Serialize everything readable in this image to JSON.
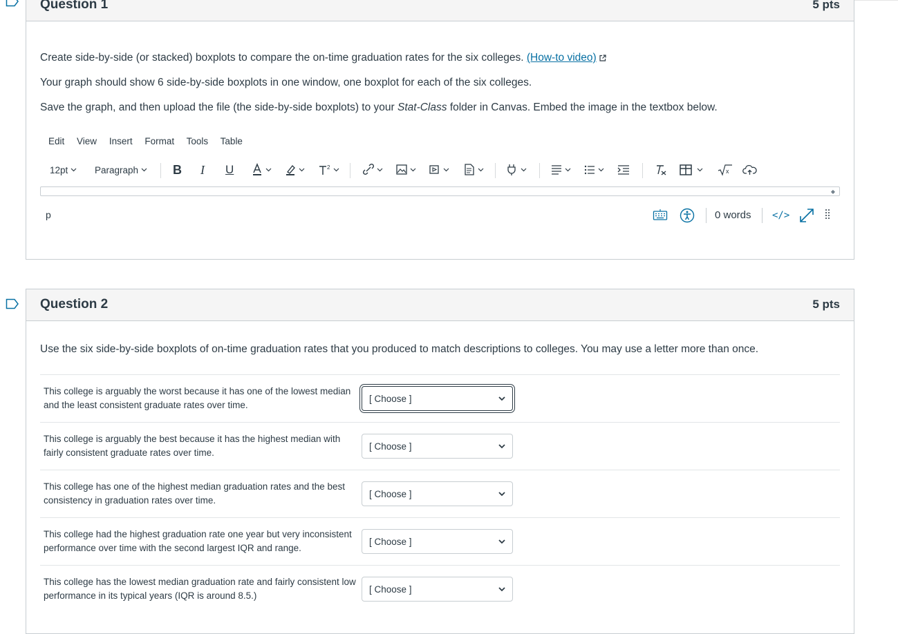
{
  "question1": {
    "title": "Question 1",
    "points": "5 pts",
    "text_1": "Create side-by-side (or stacked) boxplots to compare the on-time graduation rates for the six colleges.",
    "link": "(How-to video)",
    "text_2": "Your graph should show 6 side-by-side boxplots in one window, one boxplot for each of the six colleges.",
    "text_3a": "Save the graph, and then upload the file (the side-by-side boxplots) to your",
    "text_3b": "Stat-Class",
    "text_3c": "folder in Canvas. Embed the image in the textbox below."
  },
  "editor": {
    "menu": [
      "Edit",
      "View",
      "Insert",
      "Format",
      "Tools",
      "Table"
    ],
    "font_size": "12pt",
    "block_format": "Paragraph",
    "path": "p",
    "word_count": "0 words",
    "html_toggle": "</>"
  },
  "question2": {
    "title": "Question 2",
    "points": "5 pts",
    "text": "Use the six side-by-side boxplots of on-time graduation rates that you produced to match descriptions to colleges. You may use a letter more than once.",
    "rows": [
      {
        "label": "This college is arguably the worst because it has one of the lowest median and the least consistent graduate rates over time.",
        "value": "[ Choose ]"
      },
      {
        "label": "This college is arguably the best because it has the highest median with fairly consistent graduate rates over time.",
        "value": "[ Choose ]"
      },
      {
        "label": "This college has one of the highest median graduation rates and the best consistency in graduation rates over time.",
        "value": "[ Choose ]"
      },
      {
        "label": "This college had the highest graduation rate one year but very inconsistent performance over time with the second largest IQR and range.",
        "value": "[ Choose ]"
      },
      {
        "label": "This college has the lowest median graduation rate and fairly consistent low performance in its typical years (IQR is around 8.5.)",
        "value": "[ Choose ]"
      }
    ]
  },
  "colors": {
    "link": "#0770a3",
    "flag": "#0770a3",
    "text": "#2d3b45"
  }
}
